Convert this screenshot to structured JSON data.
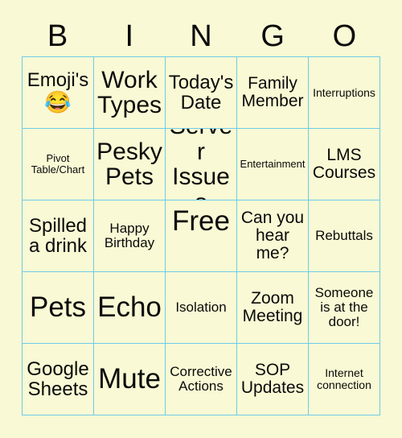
{
  "header": {
    "letters": [
      "B",
      "I",
      "N",
      "G",
      "O"
    ]
  },
  "colors": {
    "background": "#f9f9d5",
    "cell_background": "#f9f9d5",
    "grid_border": "#6ecbe8",
    "text": "#0a0a0a"
  },
  "grid": {
    "columns": 5,
    "rows": 5,
    "cells": [
      {
        "text": "Emoji's",
        "emoji": "😂",
        "emoji_name": "face-with-tears-of-joy",
        "size": "lg",
        "column": "B",
        "row": 1
      },
      {
        "text": "Work Types",
        "size": "xl",
        "column": "I",
        "row": 1
      },
      {
        "text": "Today's Date",
        "size": "lg",
        "column": "N",
        "row": 1
      },
      {
        "text": "Family Member",
        "size": "md",
        "column": "G",
        "row": 1
      },
      {
        "text": "Interruptions",
        "size": "xs",
        "column": "O",
        "row": 1
      },
      {
        "text": "Pivot Table/Chart",
        "size": "xxs",
        "column": "B",
        "row": 2
      },
      {
        "text": "Pesky Pets",
        "size": "xl",
        "column": "I",
        "row": 2
      },
      {
        "text": "Server Issues",
        "size": "xl",
        "column": "N",
        "row": 2
      },
      {
        "text": "Entertainment",
        "size": "xxs",
        "column": "G",
        "row": 2
      },
      {
        "text": "LMS Courses",
        "size": "md",
        "column": "O",
        "row": 2
      },
      {
        "text": "Spilled a drink",
        "size": "lg",
        "column": "B",
        "row": 3
      },
      {
        "text": "Happy Birthday",
        "size": "sm",
        "column": "I",
        "row": 3
      },
      {
        "text": "Free",
        "size": "xxl",
        "column": "N",
        "row": 3,
        "free_space": true
      },
      {
        "text": "Can you hear me?",
        "size": "md",
        "column": "G",
        "row": 3
      },
      {
        "text": "Rebuttals",
        "size": "sm",
        "column": "O",
        "row": 3
      },
      {
        "text": "Pets",
        "size": "xxl",
        "column": "B",
        "row": 4
      },
      {
        "text": "Echo",
        "size": "xxl",
        "column": "I",
        "row": 4
      },
      {
        "text": "Isolation",
        "size": "sm",
        "column": "N",
        "row": 4
      },
      {
        "text": "Zoom Meeting",
        "size": "md",
        "column": "G",
        "row": 4
      },
      {
        "text": "Someone is at the door!",
        "size": "sm",
        "column": "O",
        "row": 4
      },
      {
        "text": "Google Sheets",
        "size": "lg",
        "column": "B",
        "row": 5
      },
      {
        "text": "Mute",
        "size": "xxl",
        "column": "I",
        "row": 5
      },
      {
        "text": "Corrective Actions",
        "size": "sm",
        "column": "N",
        "row": 5
      },
      {
        "text": "SOP Updates",
        "size": "md",
        "column": "G",
        "row": 5
      },
      {
        "text": "Internet connection",
        "size": "xs",
        "column": "O",
        "row": 5
      }
    ]
  }
}
